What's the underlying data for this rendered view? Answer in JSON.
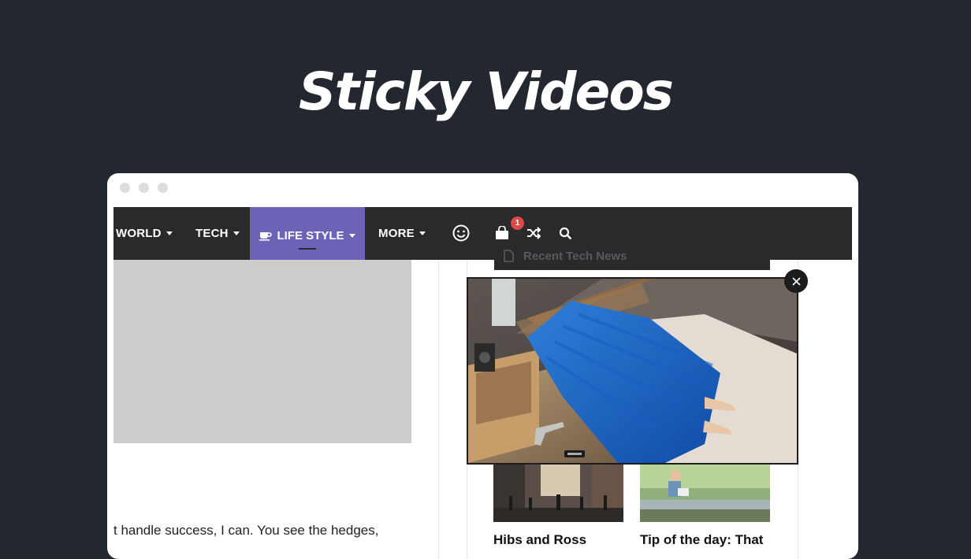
{
  "headline": "Sticky Videos",
  "nav": {
    "items": [
      {
        "label": "WORLD"
      },
      {
        "label": "TECH"
      },
      {
        "label": "LIFE STYLE",
        "active": true
      },
      {
        "label": "MORE"
      }
    ],
    "cart_count": "1"
  },
  "search_dropdown": {
    "item": "Recent Tech News"
  },
  "article": {
    "body_text": "t handle success, I can. You see the hedges,"
  },
  "cards": [
    {
      "title": "Hibs and Ross"
    },
    {
      "title": "Tip of the day: That"
    }
  ],
  "video": {
    "state": "playing"
  },
  "colors": {
    "page_bg": "#232830",
    "navbar_bg": "#2a2a2c",
    "active_tab": "#6b63b5",
    "badge": "#e04848"
  }
}
